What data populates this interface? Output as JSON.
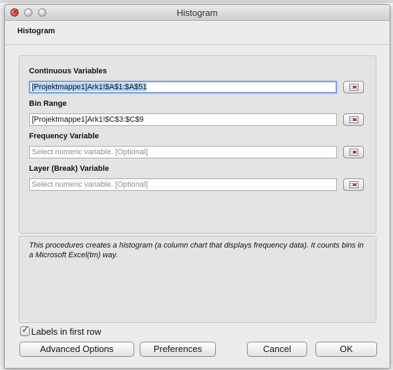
{
  "window": {
    "title": "Histogram"
  },
  "dialog": {
    "heading": "Histogram"
  },
  "fields": [
    {
      "label": "Continuous Variables",
      "value": "[Projektmappe1]Ark1!$A$1:$A$51",
      "placeholder": ""
    },
    {
      "label": "Bin Range",
      "value": "[Projektmappe1]Ark1!$C$3:$C$9",
      "placeholder": ""
    },
    {
      "label": "Frequency Variable",
      "value": "",
      "placeholder": "Select numeric variable. [Optional]"
    },
    {
      "label": "Layer (Break) Variable",
      "value": "",
      "placeholder": "Select numeric variable. [Optional]"
    }
  ],
  "description": "This procedures creates a histogram (a column chart that displays frequency data). It counts bins in a Microsoft Excel(tm) way.",
  "options": {
    "labels_first_row": "Labels in first row",
    "labels_first_row_checked": true
  },
  "buttons": {
    "advanced": "Advanced Options",
    "preferences": "Preferences",
    "cancel": "Cancel",
    "ok": "OK"
  },
  "colors": {
    "focus": "#7aa6d9",
    "selection": "#b5d4f7"
  }
}
